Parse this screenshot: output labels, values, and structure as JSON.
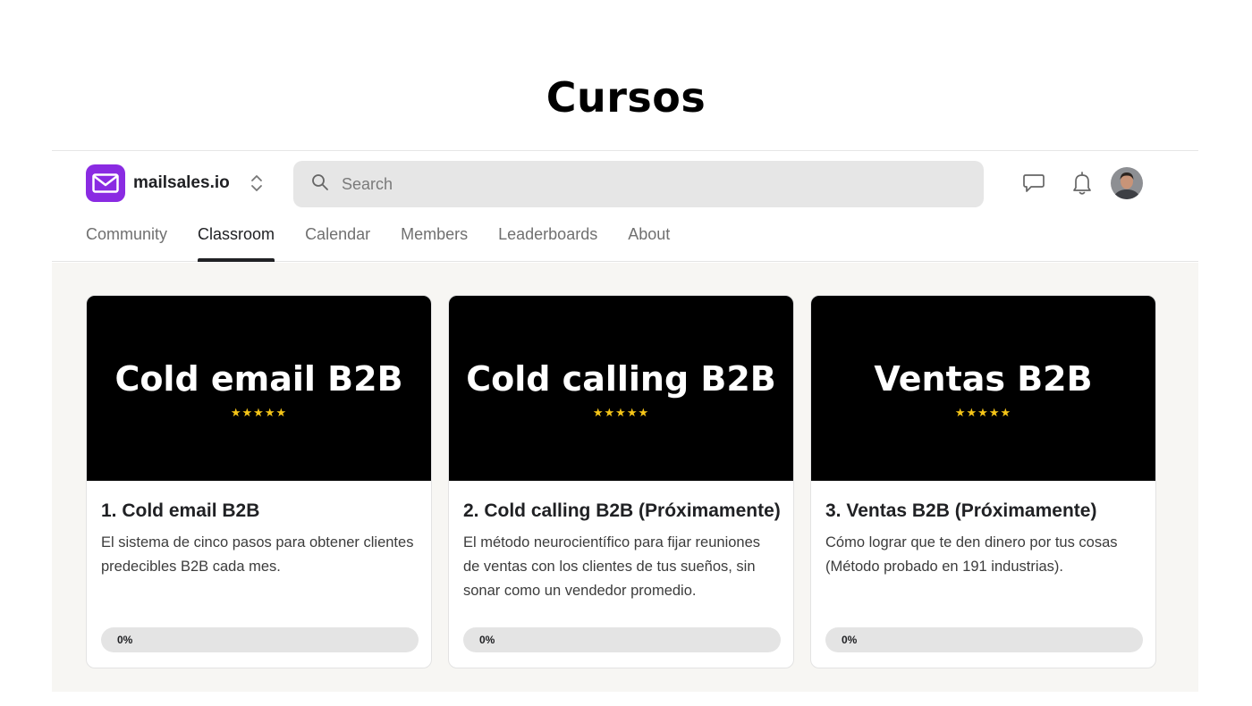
{
  "page": {
    "heading": "Cursos"
  },
  "brand": {
    "name": "mailsales.io",
    "logo_icon": "mail-envelope-icon",
    "switch_icon": "chevron-up-down-icon",
    "color": "#8a2be2"
  },
  "search": {
    "placeholder": "Search",
    "value": ""
  },
  "header_icons": [
    "chat-icon",
    "bell-icon",
    "avatar"
  ],
  "tabs": [
    {
      "label": "Community",
      "active": false
    },
    {
      "label": "Classroom",
      "active": true
    },
    {
      "label": "Calendar",
      "active": false
    },
    {
      "label": "Members",
      "active": false
    },
    {
      "label": "Leaderboards",
      "active": false
    },
    {
      "label": "About",
      "active": false
    }
  ],
  "courses": [
    {
      "banner_title": "Cold email B2B",
      "stars": "★★★★★",
      "title": "1. Cold email B2B",
      "description": "El sistema de cinco pasos para obtener clientes predecibles B2B cada mes.",
      "progress_label": "0%",
      "progress": 0
    },
    {
      "banner_title": "Cold calling B2B",
      "stars": "★★★★★",
      "title": "2. Cold calling B2B (Próximamente)",
      "description": "El método neurocientífico para fijar reuniones de ventas con los clientes de tus sueños, sin sonar como un vendedor promedio.",
      "progress_label": "0%",
      "progress": 0
    },
    {
      "banner_title": "Ventas B2B",
      "stars": "★★★★★",
      "title": "3. Ventas B2B (Próximamente)",
      "description": "Cómo lograr que te den dinero por tus cosas (Método probado en 191 industrias).",
      "progress_label": "0%",
      "progress": 0
    }
  ]
}
